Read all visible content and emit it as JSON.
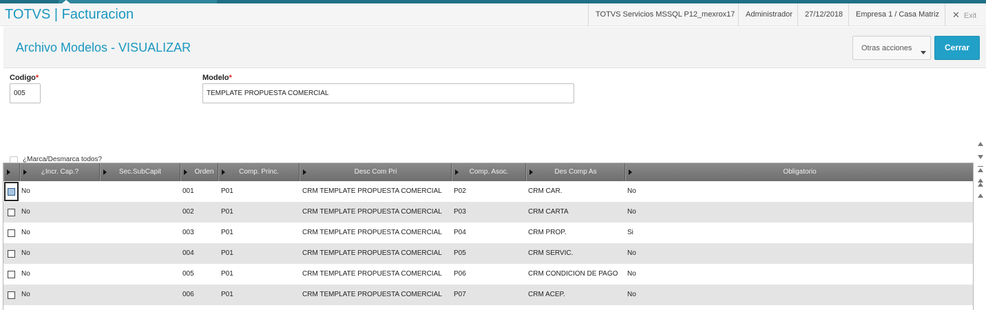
{
  "app": {
    "title": "TOTVS | Facturacion",
    "server": "TOTVS Servicios MSSQL P12_mexrox17",
    "user": "Administrador",
    "date": "27/12/2018",
    "company": "Empresa 1 / Casa Matriz",
    "exit_label": "Exit",
    "exit_icon": "close-x-icon",
    "accent_color": "#1a97c0",
    "primary_button_color": "#21a0c8"
  },
  "page": {
    "title": "Archivo Modelos - VISUALIZAR",
    "otras_acciones": "Otras acciones",
    "cerrar": "Cerrar"
  },
  "form": {
    "codigo_label": "Codigo",
    "codigo_value": "005",
    "modelo_label": "Modelo",
    "modelo_value": "TEMPLATE PROPUESTA COMERCIAL",
    "required_mark": "*"
  },
  "grid": {
    "marca_label": "¿Marca/Desmarca todos?",
    "columns": [
      "",
      "¿Incr. Cap.?",
      "Sec.SubCapit",
      "Orden",
      "Comp. Princ.",
      "Desc Com Pri",
      "Comp. Asoc.",
      "Des Comp As",
      "Obligatorio"
    ],
    "rows": [
      {
        "incr": "No",
        "sec": "",
        "orden": "001",
        "princ": "P01",
        "desc_pri": "CRM TEMPLATE PROPUESTA COMERCIAL",
        "asoc": "P02",
        "desc_as": "CRM CAR.",
        "oblig": "No",
        "checked": true
      },
      {
        "incr": "No",
        "sec": "",
        "orden": "002",
        "princ": "P01",
        "desc_pri": "CRM TEMPLATE PROPUESTA COMERCIAL",
        "asoc": "P03",
        "desc_as": "CRM CARTA",
        "oblig": "No",
        "checked": false
      },
      {
        "incr": "No",
        "sec": "",
        "orden": "003",
        "princ": "P01",
        "desc_pri": "CRM TEMPLATE PROPUESTA COMERCIAL",
        "asoc": "P04",
        "desc_as": "CRM PROP.",
        "oblig": "Si",
        "checked": false
      },
      {
        "incr": "No",
        "sec": "",
        "orden": "004",
        "princ": "P01",
        "desc_pri": "CRM TEMPLATE PROPUESTA COMERCIAL",
        "asoc": "P05",
        "desc_as": "CRM SERVIC.",
        "oblig": "No",
        "checked": false
      },
      {
        "incr": "No",
        "sec": "",
        "orden": "005",
        "princ": "P01",
        "desc_pri": "CRM TEMPLATE PROPUESTA COMERCIAL",
        "asoc": "P06",
        "desc_as": "CRM CONDICION DE PAGO",
        "oblig": "No",
        "checked": false
      },
      {
        "incr": "No",
        "sec": "",
        "orden": "006",
        "princ": "P01",
        "desc_pri": "CRM TEMPLATE PROPUESTA COMERCIAL",
        "asoc": "P07",
        "desc_as": "CRM ACEP.",
        "oblig": "No",
        "checked": false
      }
    ]
  }
}
